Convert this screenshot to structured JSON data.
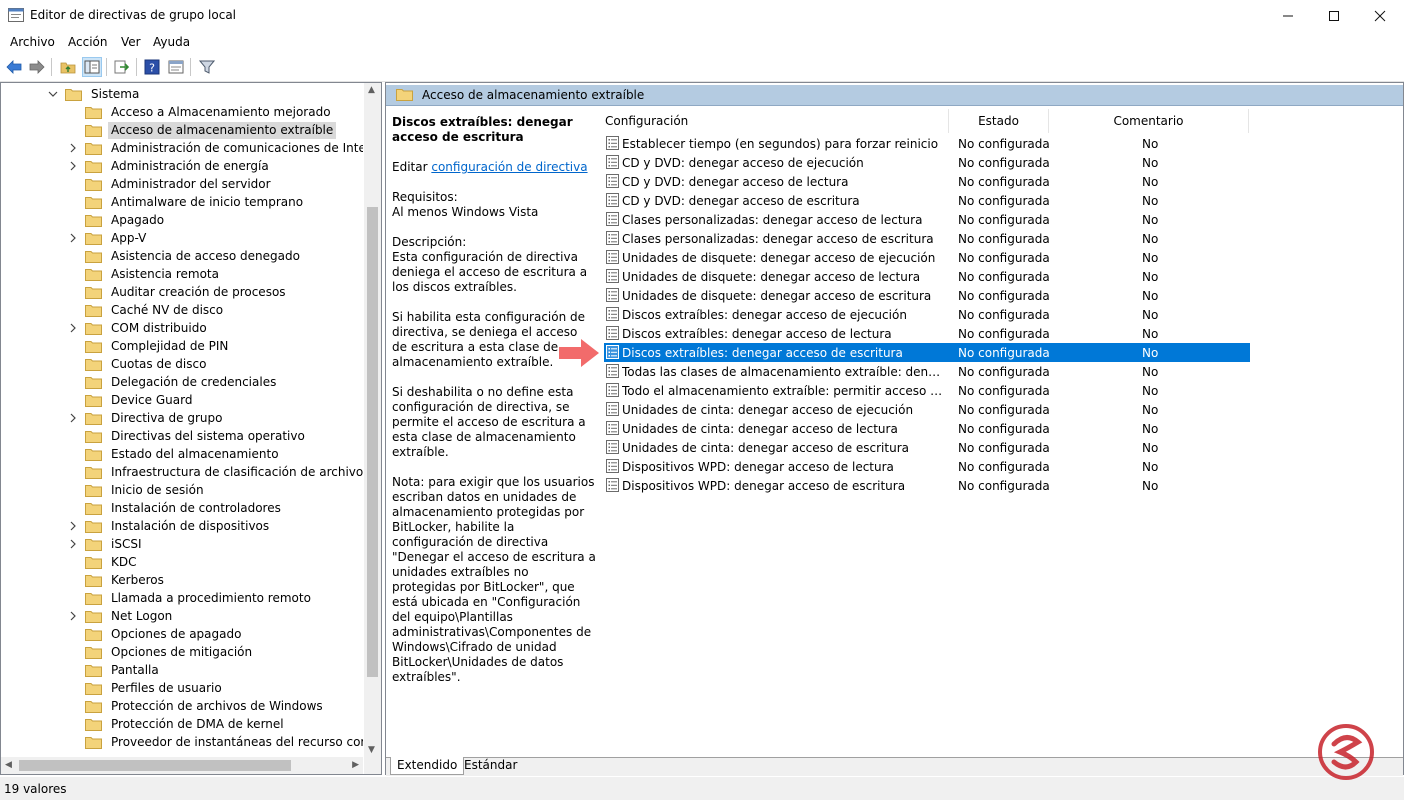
{
  "window": {
    "title": "Editor de directivas de grupo local"
  },
  "menu": [
    "Archivo",
    "Acción",
    "Ver",
    "Ayuda"
  ],
  "tree": {
    "root": "Sistema",
    "items": [
      {
        "label": "Acceso a Almacenamiento mejorado",
        "expandable": false
      },
      {
        "label": "Acceso de almacenamiento extraíble",
        "expandable": false,
        "selected": true
      },
      {
        "label": "Administración de comunicaciones de Internet",
        "expandable": true
      },
      {
        "label": "Administración de energía",
        "expandable": true
      },
      {
        "label": "Administrador del servidor",
        "expandable": false
      },
      {
        "label": "Antimalware de inicio temprano",
        "expandable": false
      },
      {
        "label": "Apagado",
        "expandable": false
      },
      {
        "label": "App-V",
        "expandable": true
      },
      {
        "label": "Asistencia de acceso denegado",
        "expandable": false
      },
      {
        "label": "Asistencia remota",
        "expandable": false
      },
      {
        "label": "Auditar creación de procesos",
        "expandable": false
      },
      {
        "label": "Caché NV de disco",
        "expandable": false
      },
      {
        "label": "COM distribuido",
        "expandable": true
      },
      {
        "label": "Complejidad de PIN",
        "expandable": false
      },
      {
        "label": "Cuotas de disco",
        "expandable": false
      },
      {
        "label": "Delegación de credenciales",
        "expandable": false
      },
      {
        "label": "Device Guard",
        "expandable": false
      },
      {
        "label": "Directiva de grupo",
        "expandable": true
      },
      {
        "label": "Directivas del sistema operativo",
        "expandable": false
      },
      {
        "label": "Estado del almacenamiento",
        "expandable": false
      },
      {
        "label": "Infraestructura de clasificación de archivos",
        "expandable": false
      },
      {
        "label": "Inicio de sesión",
        "expandable": false
      },
      {
        "label": "Instalación de controladores",
        "expandable": false
      },
      {
        "label": "Instalación de dispositivos",
        "expandable": true
      },
      {
        "label": "iSCSI",
        "expandable": true
      },
      {
        "label": "KDC",
        "expandable": false
      },
      {
        "label": "Kerberos",
        "expandable": false
      },
      {
        "label": "Llamada a procedimiento remoto",
        "expandable": false
      },
      {
        "label": "Net Logon",
        "expandable": true
      },
      {
        "label": "Opciones de apagado",
        "expandable": false
      },
      {
        "label": "Opciones de mitigación",
        "expandable": false
      },
      {
        "label": "Pantalla",
        "expandable": false
      },
      {
        "label": "Perfiles de usuario",
        "expandable": false
      },
      {
        "label": "Protección de archivos de Windows",
        "expandable": false
      },
      {
        "label": "Protección de DMA de kernel",
        "expandable": false
      },
      {
        "label": "Proveedor de instantáneas del recurso compartido de archivos",
        "expandable": false
      }
    ]
  },
  "right": {
    "header": "Acceso de almacenamiento extraíble",
    "description": {
      "title": "Discos extraíbles: denegar acceso de escritura",
      "edit_prefix": "Editar ",
      "edit_link": "configuración de directiva",
      "requirements_label": "Requisitos:",
      "requirements": "Al menos Windows Vista",
      "description_label": "Descripción:",
      "p1": "Esta configuración de directiva deniega el acceso de escritura a los discos extraíbles.",
      "p2": "Si habilita esta configuración de directiva, se deniega el acceso de escritura a esta clase de almacenamiento extraíble.",
      "p3": "Si deshabilita o no define esta configuración de directiva, se permite el acceso de escritura a esta clase de almacenamiento extraíble.",
      "p4": "Nota: para exigir que los usuarios escriban datos en unidades de almacenamiento protegidas por BitLocker, habilite la configuración de directiva \"Denegar el acceso de escritura a unidades extraíbles no protegidas por BitLocker\", que está ubicada en \"Configuración del equipo\\Plantillas administrativas\\Componentes de Windows\\Cifrado de unidad BitLocker\\Unidades de datos extraíbles\"."
    },
    "columns": [
      "Configuración",
      "Estado",
      "Comentario"
    ],
    "rows": [
      {
        "name": "Establecer tiempo (en segundos) para forzar reinicio",
        "state": "No configurada",
        "comment": "No"
      },
      {
        "name": "CD y DVD: denegar acceso de ejecución",
        "state": "No configurada",
        "comment": "No"
      },
      {
        "name": "CD y DVD: denegar acceso de lectura",
        "state": "No configurada",
        "comment": "No"
      },
      {
        "name": "CD y DVD: denegar acceso de escritura",
        "state": "No configurada",
        "comment": "No"
      },
      {
        "name": "Clases personalizadas: denegar acceso de lectura",
        "state": "No configurada",
        "comment": "No"
      },
      {
        "name": "Clases personalizadas: denegar acceso de escritura",
        "state": "No configurada",
        "comment": "No"
      },
      {
        "name": "Unidades de disquete: denegar acceso de ejecución",
        "state": "No configurada",
        "comment": "No"
      },
      {
        "name": "Unidades de disquete: denegar acceso de lectura",
        "state": "No configurada",
        "comment": "No"
      },
      {
        "name": "Unidades de disquete: denegar acceso de escritura",
        "state": "No configurada",
        "comment": "No"
      },
      {
        "name": "Discos extraíbles: denegar acceso de ejecución",
        "state": "No configurada",
        "comment": "No"
      },
      {
        "name": "Discos extraíbles: denegar acceso de lectura",
        "state": "No configurada",
        "comment": "No"
      },
      {
        "name": "Discos extraíbles: denegar acceso de escritura",
        "state": "No configurada",
        "comment": "No",
        "selected": true
      },
      {
        "name": "Todas las clases de almacenamiento extraíble: denegar acce...",
        "state": "No configurada",
        "comment": "No"
      },
      {
        "name": "Todo el almacenamiento extraíble: permitir acceso directo e...",
        "state": "No configurada",
        "comment": "No"
      },
      {
        "name": "Unidades de cinta: denegar acceso de ejecución",
        "state": "No configurada",
        "comment": "No"
      },
      {
        "name": "Unidades de cinta: denegar acceso de lectura",
        "state": "No configurada",
        "comment": "No"
      },
      {
        "name": "Unidades de cinta: denegar acceso de escritura",
        "state": "No configurada",
        "comment": "No"
      },
      {
        "name": "Dispositivos WPD: denegar acceso de lectura",
        "state": "No configurada",
        "comment": "No"
      },
      {
        "name": "Dispositivos WPD: denegar acceso de escritura",
        "state": "No configurada",
        "comment": "No"
      }
    ],
    "tabs": [
      "Extendido",
      "Estándar"
    ]
  },
  "status": "19 valores",
  "colors": {
    "selection": "#0078d7",
    "header_band": "#b4cbe1",
    "folder": "#e8c266",
    "pointer": "#f26b6b",
    "watermark": "#c7222a"
  },
  "icons": [
    "back-arrow-icon",
    "forward-arrow-icon",
    "up-folder-icon",
    "show-tree-icon",
    "export-icon",
    "help-icon",
    "properties-icon",
    "filter-icon",
    "folder-icon",
    "policy-setting-icon",
    "pointer-arrow-icon"
  ]
}
